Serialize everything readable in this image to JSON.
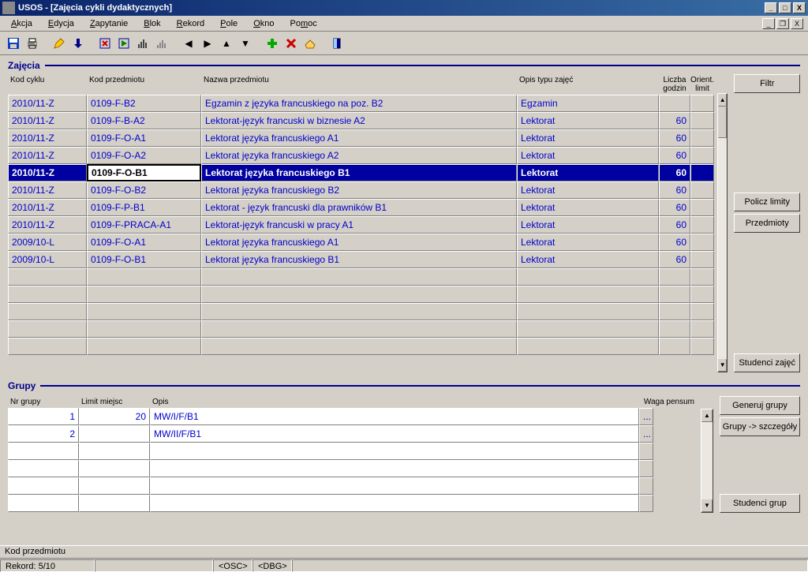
{
  "window": {
    "title": "USOS - [Zajęcia cykli dydaktycznych]"
  },
  "menu": {
    "items": [
      "Akcja",
      "Edycja",
      "Zapytanie",
      "Blok",
      "Rekord",
      "Pole",
      "Okno",
      "Pomoc"
    ]
  },
  "sections": {
    "zajecia": "Zajęcia",
    "grupy": "Grupy"
  },
  "zajecia": {
    "headers": {
      "kod_cyklu": "Kod cyklu",
      "kod_przedmiotu": "Kod przedmiotu",
      "nazwa": "Nazwa przedmiotu",
      "opis_typu": "Opis typu zajęć",
      "liczba_godzin_1": "Liczba",
      "liczba_godzin_2": "godzin",
      "orient_1": "Orient.",
      "orient_2": "limit"
    },
    "rows": [
      {
        "kod_cyklu": "2010/11-Z",
        "kod_przedmiotu": "0109-F-B2",
        "nazwa": "Egzamin z języka francuskiego na poz. B2",
        "opis": "Egzamin",
        "godzin": "",
        "limit": ""
      },
      {
        "kod_cyklu": "2010/11-Z",
        "kod_przedmiotu": "0109-F-B-A2",
        "nazwa": "Lektorat-język francuski w biznesie A2",
        "opis": "Lektorat",
        "godzin": "60",
        "limit": ""
      },
      {
        "kod_cyklu": "2010/11-Z",
        "kod_przedmiotu": "0109-F-O-A1",
        "nazwa": "Lektorat języka francuskiego A1",
        "opis": "Lektorat",
        "godzin": "60",
        "limit": ""
      },
      {
        "kod_cyklu": "2010/11-Z",
        "kod_przedmiotu": "0109-F-O-A2",
        "nazwa": "Lektorat języka francuskiego A2",
        "opis": "Lektorat",
        "godzin": "60",
        "limit": ""
      },
      {
        "kod_cyklu": "2010/11-Z",
        "kod_przedmiotu": "0109-F-O-B1",
        "nazwa": "Lektorat języka francuskiego B1",
        "opis": "Lektorat",
        "godzin": "60",
        "limit": ""
      },
      {
        "kod_cyklu": "2010/11-Z",
        "kod_przedmiotu": "0109-F-O-B2",
        "nazwa": "Lektorat języka francuskiego B2",
        "opis": "Lektorat",
        "godzin": "60",
        "limit": ""
      },
      {
        "kod_cyklu": "2010/11-Z",
        "kod_przedmiotu": "0109-F-P-B1",
        "nazwa": "Lektorat - język francuski dla prawników B1",
        "opis": "Lektorat",
        "godzin": "60",
        "limit": ""
      },
      {
        "kod_cyklu": "2010/11-Z",
        "kod_przedmiotu": "0109-F-PRACA-A1",
        "nazwa": "Lektorat-język francuski w pracy A1",
        "opis": "Lektorat",
        "godzin": "60",
        "limit": ""
      },
      {
        "kod_cyklu": "2009/10-L",
        "kod_przedmiotu": "0109-F-O-A1",
        "nazwa": "Lektorat języka francuskiego A1",
        "opis": "Lektorat",
        "godzin": "60",
        "limit": ""
      },
      {
        "kod_cyklu": "2009/10-L",
        "kod_przedmiotu": "0109-F-O-B1",
        "nazwa": "Lektorat języka francuskiego B1",
        "opis": "Lektorat",
        "godzin": "60",
        "limit": ""
      }
    ],
    "selected_index": 4
  },
  "grupy": {
    "headers": {
      "nr": "Nr grupy",
      "limit": "Limit miejsc",
      "opis": "Opis",
      "waga": "Waga pensum"
    },
    "rows": [
      {
        "nr": "1",
        "limit": "20",
        "opis": "MW/I/F/B1"
      },
      {
        "nr": "2",
        "limit": "",
        "opis": "MW/II/F/B1"
      }
    ]
  },
  "buttons": {
    "filtr": "Filtr",
    "policz_limity": "Policz limity",
    "przedmioty": "Przedmioty",
    "studenci_zajec": "Studenci zajęć",
    "generuj_grupy": "Generuj grupy",
    "grupy_szczegoly": "Grupy -> szczegóły",
    "studenci_grup": "Studenci grup"
  },
  "status": {
    "field_hint": "Kod przedmiotu",
    "record": "Rekord: 5/10",
    "osc": "<OSC>",
    "dbg": "<DBG>"
  }
}
